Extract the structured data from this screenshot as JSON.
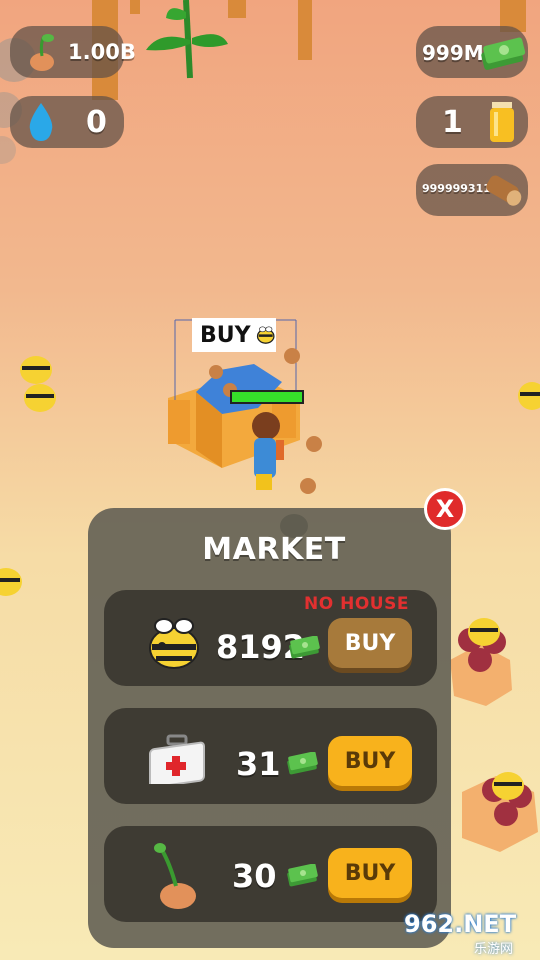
{
  "hud": {
    "seeds": "1.00B",
    "water": "0",
    "cash": "999M",
    "honey": "1",
    "wood": "999999311",
    "icons": [
      "sprout-seed-icon",
      "water-drop-icon",
      "cash-stack-icon",
      "honey-jar-icon",
      "wood-log-icon"
    ]
  },
  "world": {
    "buy_sign": "BUY",
    "health_bar_fraction": 1.0
  },
  "market": {
    "title": "MARKET",
    "close_label": "X",
    "items": [
      {
        "icon": "bee-icon",
        "price": "8192",
        "status": "NO HOUSE",
        "button": "BUY",
        "enabled": false
      },
      {
        "icon": "first-aid-kit-icon",
        "price": "31",
        "button": "BUY",
        "enabled": true
      },
      {
        "icon": "sprout-seed-icon",
        "price": "30",
        "button": "BUY",
        "enabled": true
      }
    ]
  },
  "watermark": {
    "brand": "962.NET",
    "sub": "乐游网"
  },
  "colors": {
    "cash_green": "#58b84a",
    "buy_orange": "#f8b21c",
    "buy_disabled": "#a77a3b",
    "alert_red": "#e02b2b"
  }
}
